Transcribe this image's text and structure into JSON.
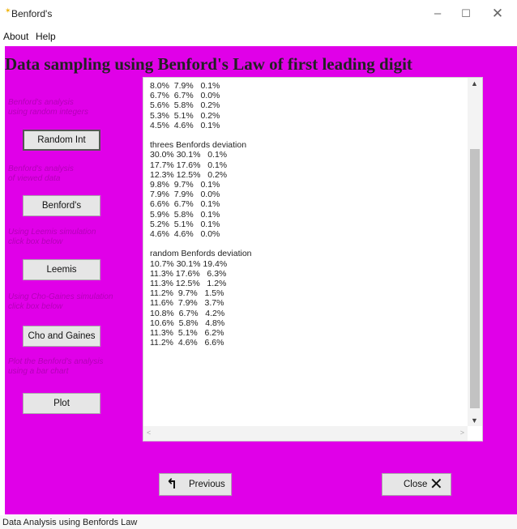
{
  "window": {
    "title": "Benford's",
    "app_icon": "feather-icon",
    "minimize_glyph": "–",
    "maximize_glyph": "☐",
    "close_glyph": "✕"
  },
  "menu": {
    "about": "About",
    "help": "Help"
  },
  "heading": "Data sampling using Benford's Law of first leading digit",
  "colors": {
    "background": "#e000e8",
    "label_text": "#b400b8"
  },
  "sidebar": {
    "random_label": "Benford's analysis\nusing random integers",
    "random_button": "Random Int",
    "benford_label": "Benford's analysis\nof viewed data",
    "benford_button": "Benford's",
    "leemis_label": "Using Leemis simulation\nclick box below",
    "leemis_button": "Leemis",
    "cho_label": "Using Cho-Gaines simulation\nclick box below",
    "cho_button": "Cho and Gaines",
    "plot_label": "Plot the Benford's analysis\nusing a bar chart",
    "plot_button": "Plot"
  },
  "output_text": "8.0%  7.9%   0.1%\n6.7%  6.7%   0.0%\n5.6%  5.8%   0.2%\n5.3%  5.1%   0.2%\n4.5%  4.6%   0.1%\n\nthrees Benfords deviation\n30.0% 30.1%   0.1%\n17.7% 17.6%   0.1%\n12.3% 12.5%   0.2%\n9.8%  9.7%   0.1%\n7.9%  7.9%   0.0%\n6.6%  6.7%   0.1%\n5.9%  5.8%   0.1%\n5.2%  5.1%   0.1%\n4.6%  4.6%   0.0%\n\nrandom Benfords deviation\n10.7% 30.1% 19.4%\n11.3% 17.6%   6.3%\n11.3% 12.5%   1.2%\n11.2%  9.7%   1.5%\n11.6%  7.9%   3.7%\n10.8%  6.7%   4.2%\n10.6%  5.8%   4.8%\n11.3%  5.1%   6.2%\n11.2%  4.6%   6.6%",
  "scrollbar": {
    "up": "▲",
    "down": "▼",
    "left": "<",
    "right": ">"
  },
  "buttons": {
    "previous": "Previous",
    "previous_icon": "↰",
    "close": "Close",
    "close_icon": "✕"
  },
  "status": "Data Analysis using Benfords Law"
}
